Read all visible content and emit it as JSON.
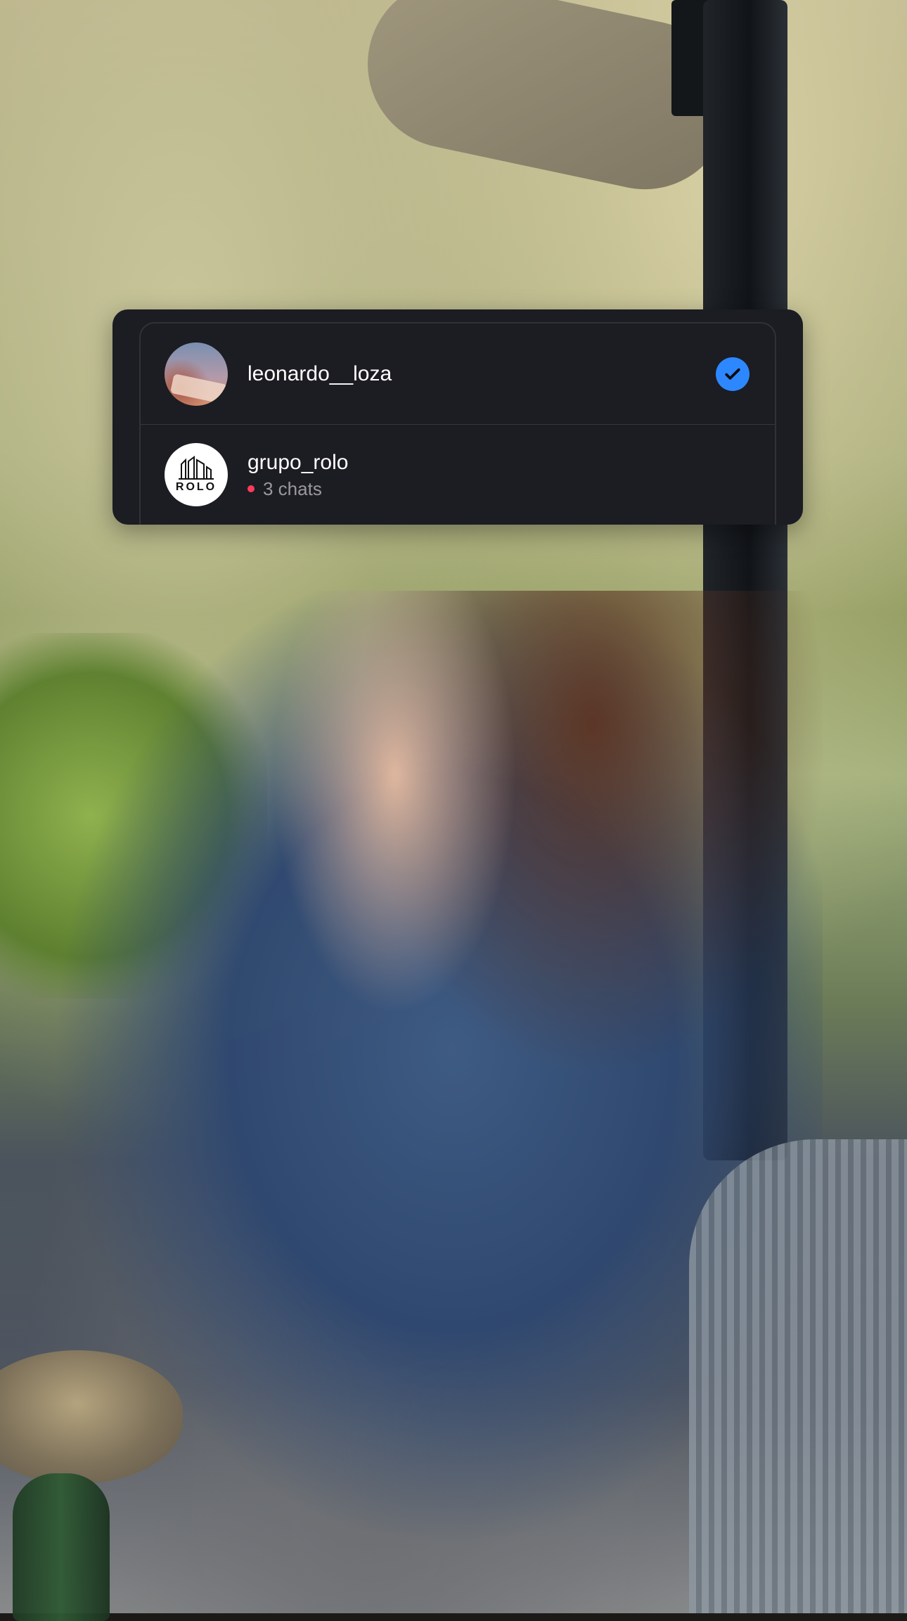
{
  "scene": {
    "background_colors": [
      "#b7ad86",
      "#9aa36f",
      "#7c8c4b",
      "#4f5862",
      "#a6a8a9"
    ]
  },
  "account_switcher": {
    "accent_color": "#2d88ff",
    "accounts": [
      {
        "username": "leonardo__loza",
        "avatar_icon": "profile-photo-icon",
        "selected": true,
        "badge_icon": "checkmark-icon"
      },
      {
        "username": "grupo_rolo",
        "avatar_icon": "rolo-logo-icon",
        "avatar_logo_text": "ROLO",
        "unread_indicator_color": "#ff3b5c",
        "meta": "3 chats"
      }
    ]
  }
}
